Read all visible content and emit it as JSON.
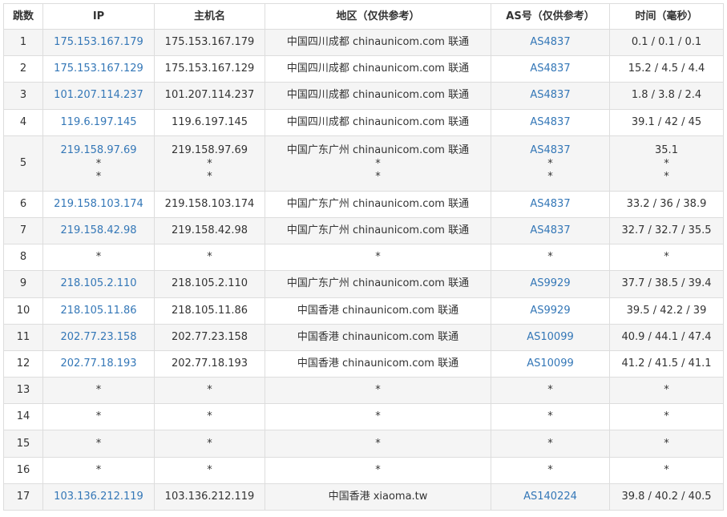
{
  "headers": {
    "hop": "跳数",
    "ip": "IP",
    "host": "主机名",
    "region": "地区（仅供参考）",
    "asn": "AS号（仅供参考）",
    "time": "时间（毫秒）"
  },
  "rows": [
    {
      "hop": "1",
      "ip": "175.153.167.179",
      "host": "175.153.167.179",
      "region": "中国四川成都 chinaunicom.com 联通",
      "asn": "AS4837",
      "time": "0.1 / 0.1 / 0.1"
    },
    {
      "hop": "2",
      "ip": "175.153.167.129",
      "host": "175.153.167.129",
      "region": "中国四川成都 chinaunicom.com 联通",
      "asn": "AS4837",
      "time": "15.2 / 4.5 / 4.4"
    },
    {
      "hop": "3",
      "ip": "101.207.114.237",
      "host": "101.207.114.237",
      "region": "中国四川成都 chinaunicom.com 联通",
      "asn": "AS4837",
      "time": "1.8 / 3.8 / 2.4"
    },
    {
      "hop": "4",
      "ip": "119.6.197.145",
      "host": "119.6.197.145",
      "region": "中国四川成都 chinaunicom.com 联通",
      "asn": "AS4837",
      "time": "39.1 / 42 / 45"
    },
    {
      "hop": "5",
      "ip": "219.158.97.69",
      "host": "219.158.97.69",
      "region": "中国广东广州 chinaunicom.com 联通",
      "asn": "AS4837",
      "time": "35.1",
      "extra": "*"
    },
    {
      "hop": "6",
      "ip": "219.158.103.174",
      "host": "219.158.103.174",
      "region": "中国广东广州 chinaunicom.com 联通",
      "asn": "AS4837",
      "time": "33.2 / 36 / 38.9"
    },
    {
      "hop": "7",
      "ip": "219.158.42.98",
      "host": "219.158.42.98",
      "region": "中国广东广州 chinaunicom.com 联通",
      "asn": "AS4837",
      "time": "32.7 / 32.7 / 35.5"
    },
    {
      "hop": "8",
      "ip": "*",
      "host": "*",
      "region": "*",
      "asn": "*",
      "time": "*"
    },
    {
      "hop": "9",
      "ip": "218.105.2.110",
      "host": "218.105.2.110",
      "region": "中国广东广州 chinaunicom.com 联通",
      "asn": "AS9929",
      "time": "37.7 / 38.5 / 39.4"
    },
    {
      "hop": "10",
      "ip": "218.105.11.86",
      "host": "218.105.11.86",
      "region": "中国香港 chinaunicom.com 联通",
      "asn": "AS9929",
      "time": "39.5 / 42.2 / 39"
    },
    {
      "hop": "11",
      "ip": "202.77.23.158",
      "host": "202.77.23.158",
      "region": "中国香港 chinaunicom.com 联通",
      "asn": "AS10099",
      "time": "40.9 / 44.1 / 47.4"
    },
    {
      "hop": "12",
      "ip": "202.77.18.193",
      "host": "202.77.18.193",
      "region": "中国香港 chinaunicom.com 联通",
      "asn": "AS10099",
      "time": "41.2 / 41.5 / 41.1"
    },
    {
      "hop": "13",
      "ip": "*",
      "host": "*",
      "region": "*",
      "asn": "*",
      "time": "*"
    },
    {
      "hop": "14",
      "ip": "*",
      "host": "*",
      "region": "*",
      "asn": "*",
      "time": "*"
    },
    {
      "hop": "15",
      "ip": "*",
      "host": "*",
      "region": "*",
      "asn": "*",
      "time": "*"
    },
    {
      "hop": "16",
      "ip": "*",
      "host": "*",
      "region": "*",
      "asn": "*",
      "time": "*"
    },
    {
      "hop": "17",
      "ip": "103.136.212.119",
      "host": "103.136.212.119",
      "region": "中国香港 xiaoma.tw",
      "asn": "AS140224",
      "time": "39.8 / 40.2 / 40.5"
    }
  ],
  "colors": {
    "link": "#3477b7",
    "text": "#333333",
    "border": "#dddddd",
    "stripe": "#f5f5f5"
  }
}
